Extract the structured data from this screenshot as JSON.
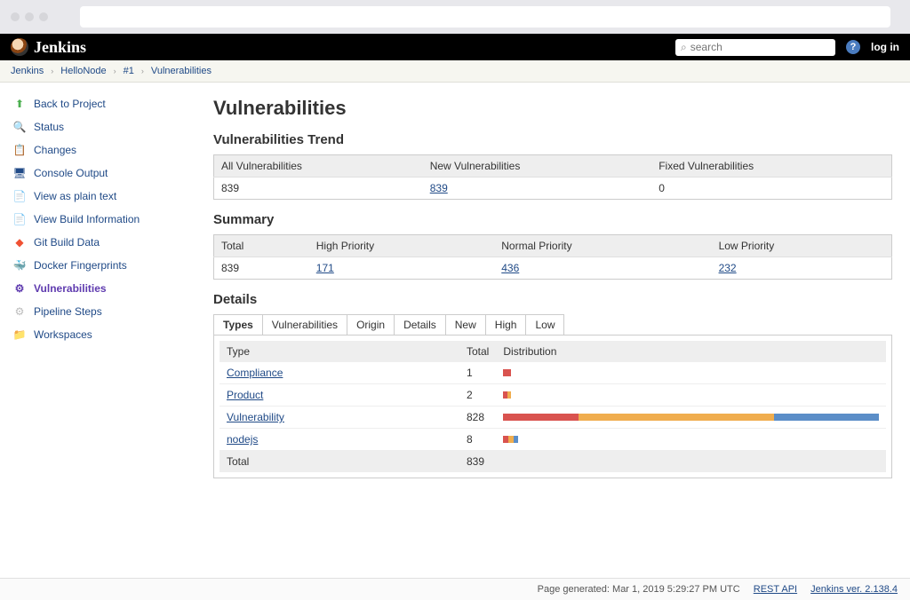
{
  "app": {
    "name": "Jenkins"
  },
  "header": {
    "search_placeholder": "search",
    "login_label": "log in"
  },
  "breadcrumb": {
    "items": [
      {
        "label": "Jenkins"
      },
      {
        "label": "HelloNode"
      },
      {
        "label": "#1"
      },
      {
        "label": "Vulnerabilities"
      }
    ]
  },
  "sidebar": {
    "items": [
      {
        "label": "Back to Project",
        "icon": "arrow-up-icon"
      },
      {
        "label": "Status",
        "icon": "search-icon"
      },
      {
        "label": "Changes",
        "icon": "list-icon"
      },
      {
        "label": "Console Output",
        "icon": "terminal-icon"
      },
      {
        "label": "View as plain text",
        "icon": "plaintext-icon"
      },
      {
        "label": "View Build Information",
        "icon": "document-icon"
      },
      {
        "label": "Git Build Data",
        "icon": "git-icon"
      },
      {
        "label": "Docker Fingerprints",
        "icon": "docker-icon"
      },
      {
        "label": "Vulnerabilities",
        "icon": "security-icon",
        "active": true
      },
      {
        "label": "Pipeline Steps",
        "icon": "pipeline-icon"
      },
      {
        "label": "Workspaces",
        "icon": "folder-icon"
      }
    ]
  },
  "page": {
    "title": "Vulnerabilities",
    "trend": {
      "heading": "Vulnerabilities Trend",
      "headers": {
        "all": "All Vulnerabilities",
        "new": "New Vulnerabilities",
        "fixed": "Fixed Vulnerabilities"
      },
      "row": {
        "all": "839",
        "new": "839",
        "fixed": "0"
      }
    },
    "summary": {
      "heading": "Summary",
      "headers": {
        "total": "Total",
        "high": "High Priority",
        "normal": "Normal Priority",
        "low": "Low Priority"
      },
      "row": {
        "total": "839",
        "high": "171",
        "normal": "436",
        "low": "232"
      }
    },
    "details": {
      "heading": "Details",
      "tabs": [
        {
          "label": "Types",
          "active": true
        },
        {
          "label": "Vulnerabilities"
        },
        {
          "label": "Origin"
        },
        {
          "label": "Details"
        },
        {
          "label": "New"
        },
        {
          "label": "High"
        },
        {
          "label": "Low"
        }
      ],
      "table": {
        "headers": {
          "type": "Type",
          "total": "Total",
          "dist": "Distribution"
        },
        "rows": [
          {
            "type": "Compliance",
            "total": "1",
            "dist": {
              "red": 1,
              "yellow": 0,
              "blue": 0,
              "scale": 2
            }
          },
          {
            "type": "Product",
            "total": "2",
            "dist": {
              "red": 1,
              "yellow": 1,
              "blue": 0,
              "scale": 2
            }
          },
          {
            "type": "Vulnerability",
            "total": "828",
            "dist": {
              "red": 20,
              "yellow": 52,
              "blue": 28,
              "scale": 100
            }
          },
          {
            "type": "nodejs",
            "total": "8",
            "dist": {
              "red": 1,
              "yellow": 1,
              "blue": 1,
              "scale": 4
            }
          }
        ],
        "total_row": {
          "label": "Total",
          "total": "839"
        }
      }
    }
  },
  "footer": {
    "generated": "Page generated: Mar 1, 2019 5:29:27 PM UTC",
    "rest_api": "REST API",
    "version": "Jenkins ver. 2.138.4"
  }
}
